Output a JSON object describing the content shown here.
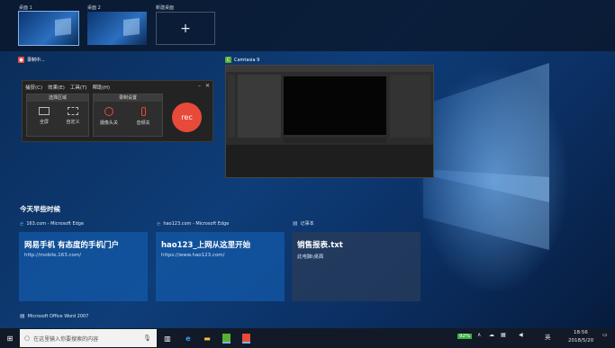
{
  "desktops": [
    {
      "label": "桌面 1",
      "active": true
    },
    {
      "label": "桌面 2",
      "active": false
    },
    {
      "label": "新建桌面",
      "icon": "plus-icon"
    }
  ],
  "windows": {
    "recorder": {
      "title": "录制中...",
      "menu": [
        "捕获(C)",
        "效果(E)",
        "工具(T)",
        "帮助(H)"
      ],
      "group_area": "选择区域",
      "group_rec": "录制设置",
      "btn_full": "全屏",
      "btn_custom": "自定义",
      "btn_camera": "摄像头关",
      "btn_audio": "音频关",
      "rec_label": "rec"
    },
    "camtasia": {
      "title": "Camtasia 9"
    }
  },
  "timeline": {
    "heading": "今天早些时候",
    "cards": [
      {
        "app": "163.com - Microsoft Edge",
        "title": "网易手机 有态度的手机门户",
        "url": "http://mobile.163.com/"
      },
      {
        "app": "hao123.com - Microsoft Edge",
        "title": "hao123_上网从这里开始",
        "url": "https://www.hao123.com/"
      },
      {
        "app": "记事本",
        "title": "销售报表.txt",
        "url": "此电脑\\桌面"
      }
    ],
    "next_app": "Microsoft Office Word 2007"
  },
  "taskbar": {
    "search_placeholder": "在这里输入你要搜索的内容",
    "battery": "92%",
    "ime": "英",
    "time": "18:56",
    "date": "2018/5/20"
  }
}
